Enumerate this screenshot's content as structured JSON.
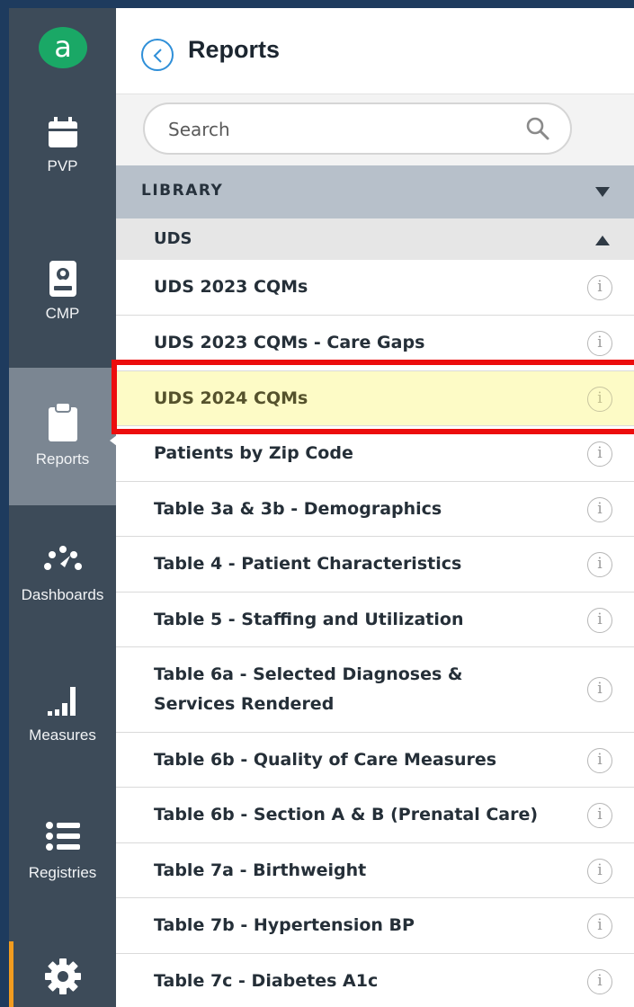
{
  "app": {
    "logo_letter": "a"
  },
  "nav": {
    "items": [
      {
        "label": "PVP",
        "icon": "calendar-icon"
      },
      {
        "label": "CMP",
        "icon": "badge-icon"
      },
      {
        "label": "Reports",
        "icon": "clipboard-icon",
        "active": true
      },
      {
        "label": "Dashboards",
        "icon": "gauge-icon"
      },
      {
        "label": "Measures",
        "icon": "signal-bars-icon"
      },
      {
        "label": "Registries",
        "icon": "list-icon"
      },
      {
        "label": "",
        "icon": "gear-icon"
      }
    ]
  },
  "header": {
    "title": "Reports"
  },
  "search": {
    "placeholder": "Search"
  },
  "library": {
    "label": "LIBRARY"
  },
  "group": {
    "label": "UDS"
  },
  "reports": [
    {
      "label": "UDS 2023 CQMs"
    },
    {
      "label": "UDS 2023 CQMs - Care Gaps"
    },
    {
      "label": "UDS 2024 CQMs",
      "highlighted": true
    },
    {
      "label": "Patients by Zip Code"
    },
    {
      "label": "Table 3a & 3b - Demographics"
    },
    {
      "label": "Table 4 - Patient Characteristics"
    },
    {
      "label": "Table 5 - Staffing and Utilization"
    },
    {
      "label": "Table 6a - Selected Diagnoses & Services Rendered"
    },
    {
      "label": "Table 6b - Quality of Care Measures"
    },
    {
      "label": "Table 6b - Section A & B (Prenatal Care)"
    },
    {
      "label": "Table 7a - Birthweight"
    },
    {
      "label": "Table 7b - Hypertension BP"
    },
    {
      "label": "Table 7c - Diabetes A1c"
    }
  ],
  "info_glyph": "i",
  "colors": {
    "nav_bg": "#3d4b59",
    "nav_active": "#7b8692",
    "accent_blue": "#2f8fd8",
    "logo_green": "#1aa866",
    "highlight_row": "#fdfbc6",
    "annotation_red": "#ec0d0d"
  }
}
